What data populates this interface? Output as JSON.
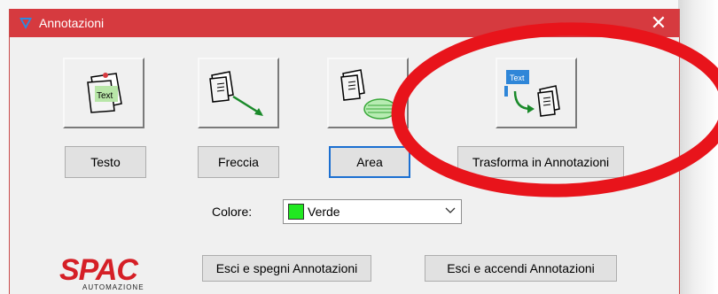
{
  "window": {
    "title": "Annotazioni",
    "close_glyph": "✕"
  },
  "tiles": [
    {
      "icon": "text-note-icon",
      "text": "Text"
    },
    {
      "icon": "arrow-note-icon"
    },
    {
      "icon": "area-note-icon"
    },
    {
      "icon": "transform-to-annotations-icon",
      "text": "Text"
    }
  ],
  "buttons": {
    "testo": "Testo",
    "freccia": "Freccia",
    "area": "Area",
    "trasforma": "Trasforma in Annotazioni",
    "esci_spegni": "Esci e spegni Annotazioni",
    "esci_accendi": "Esci e accendi Annotazioni"
  },
  "color": {
    "label": "Colore:",
    "selected": "Verde",
    "swatch_hex": "#21e821"
  },
  "logo": {
    "name": "SPAC",
    "subtitle": "AUTOMAZIONE",
    "color": "#d51f26"
  },
  "colors": {
    "titlebar": "#d63a3f",
    "focus_border": "#1b6fd1",
    "overlay_ring": "#e8141b"
  }
}
